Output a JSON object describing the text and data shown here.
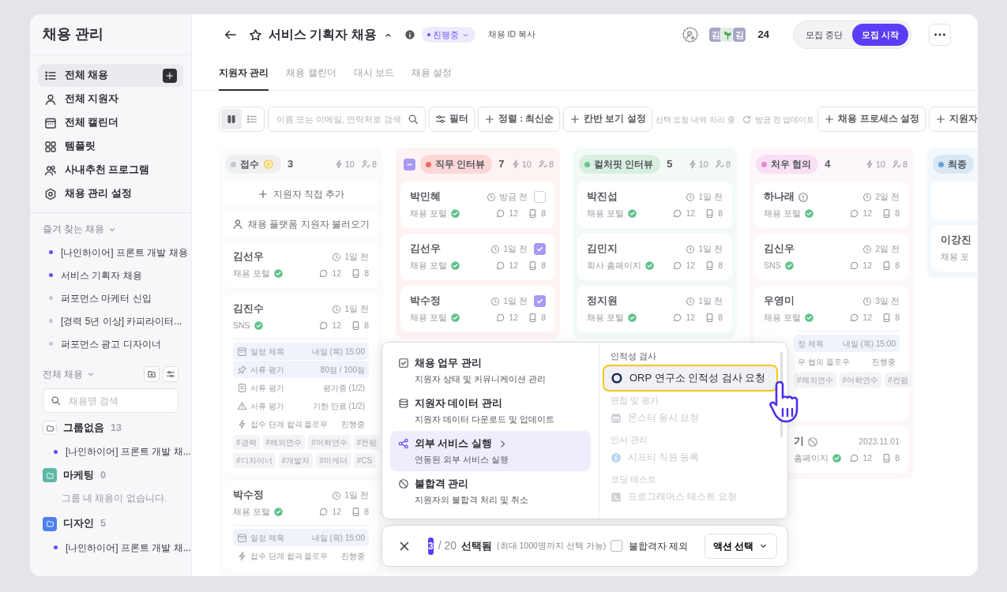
{
  "sidebar": {
    "title": "채용 관리",
    "nav": [
      {
        "kind": "list",
        "label": "전체 채용",
        "selected": true,
        "add_button": true
      },
      {
        "kind": "user",
        "label": "전체 지원자",
        "selected": false,
        "add_button": false
      },
      {
        "kind": "calendar",
        "label": "전체 캘린더",
        "selected": false,
        "add_button": false
      },
      {
        "kind": "grid",
        "label": "템플릿",
        "selected": false,
        "add_button": false
      },
      {
        "kind": "users",
        "label": "사내추천 프로그램",
        "selected": false,
        "add_button": false
      },
      {
        "kind": "hexagon",
        "label": "채용 관리 설정",
        "selected": false,
        "add_button": false
      }
    ],
    "favorites": {
      "title": "즐겨 찾는 채용",
      "items": [
        {
          "label": "[나인하이어] 프론트 개발 채용",
          "color": "#6b4cf6"
        },
        {
          "label": "서비스 기획자 채용",
          "color": "#6b4cf6"
        },
        {
          "label": "퍼포먼스 마케터 신입",
          "color": "#c3c6d0"
        },
        {
          "label": "[경력 5년 이상] 카피라이터...",
          "color": "#c3c6d0"
        },
        {
          "label": "퍼포먼스 광고 디자이너",
          "color": "#c3c6d0"
        }
      ]
    },
    "all_jobs": {
      "title": "전체 채용",
      "search_placeholder": "채용명 검색",
      "groups": [
        {
          "name": "그룹없음",
          "count": "13",
          "color": "#ffffff",
          "items": [
            {
              "label": "[나인하이어] 프론트 개발 채...",
              "color": "#6b4cf6"
            }
          ]
        },
        {
          "name": "마케팅",
          "count": "0",
          "color": "#5cb8a5",
          "empty_text": "그룹 내 채용이 없습니다."
        },
        {
          "name": "디자인",
          "count": "5",
          "color": "#4f7ff0",
          "items": [
            {
              "label": "[나인하이어] 프론트 개발 채...",
              "color": "#6b4cf6"
            }
          ]
        }
      ]
    }
  },
  "header": {
    "title": "서비스 기획자 채용",
    "status": "진행중",
    "copy_link": "채용 ID 복사",
    "avatars": [
      {
        "kind": "initial",
        "text": "김",
        "color": "#a5a6c4"
      },
      {
        "kind": "sprout",
        "color": "#dfeee0"
      },
      {
        "kind": "initial",
        "text": "김",
        "color": "#a5a6c4"
      }
    ],
    "member_count": "24",
    "recruit_toggle": [
      {
        "label": "모집 중단",
        "selected": false
      },
      {
        "label": "모집 시작",
        "selected": true
      }
    ]
  },
  "tabs": [
    {
      "label": "지원자 관리",
      "selected": true
    },
    {
      "label": "채용 캘린더",
      "selected": false
    },
    {
      "label": "대시 보드",
      "selected": false
    },
    {
      "label": "채용 설정",
      "selected": false
    }
  ],
  "toolbar": {
    "views": [
      {
        "kind": "kanban",
        "selected": true
      },
      {
        "kind": "list",
        "selected": false
      }
    ],
    "search_placeholder": "이름 또는 이메일, 연락처로 검색",
    "buttons": [
      {
        "kind": "sliders",
        "label": "필터"
      },
      {
        "kind": "plus",
        "label": "정렬 : 최신순"
      },
      {
        "kind": "plus",
        "label": "칸반 보기 설정"
      }
    ],
    "processing_text": "선택 요청 내역 처리 중",
    "updated_text": "방금 전 업데이트",
    "right_buttons": [
      {
        "kind": "plus",
        "label": "채용 프로세스 설정"
      },
      {
        "kind": "plus",
        "label": "지원자"
      }
    ]
  },
  "columns": [
    {
      "title": "접수",
      "color": "#c3c6d0",
      "indicator": true,
      "count": "3",
      "stats": [
        "10",
        "8"
      ],
      "actions": [
        {
          "kind": "add",
          "label": "지원자 직접 추가"
        },
        {
          "kind": "import",
          "label": "채용 플랫폼 지원자 불러오기"
        }
      ],
      "cards": [
        {
          "name": "김선우",
          "time": "1일 전",
          "source": "채용 포털",
          "verified": true,
          "comments": "12",
          "docs": "8"
        },
        {
          "name": "김진수",
          "time": "1일 전",
          "source": "SNS",
          "verified": true,
          "comments": "12",
          "docs": "8",
          "details": [
            {
              "kind": "calendar",
              "label": "일정 제목",
              "value": "내일 (목) 15:00",
              "highlight": true
            },
            {
              "kind": "pin",
              "label": "서류 평가",
              "value": "80점 / 100점",
              "highlight": true
            },
            {
              "kind": "note",
              "label": "서류 평가",
              "value": "평가중 (1/2)",
              "highlight": false
            },
            {
              "kind": "warning",
              "label": "서류 평가",
              "value": "기한 만료 (1/2)",
              "highlight": false
            },
            {
              "kind": "flow",
              "label": "접수 단계 합격 플로우",
              "value": "진행중",
              "highlight": false
            }
          ],
          "tags": [
            "#경력",
            "#해외연수",
            "#어학연수",
            "#컨펌",
            "#디자이너",
            "#개발자",
            "#마케터",
            "#CS"
          ]
        },
        {
          "name": "박수정",
          "time": "1일 전",
          "source": "채용 포털",
          "verified": true,
          "comments": "12",
          "docs": "8",
          "details": [
            {
              "kind": "calendar",
              "label": "일정 제목",
              "value": "내일 (목) 15:00",
              "highlight": true
            },
            {
              "kind": "flow",
              "label": "접수 단계 합격 플로우",
              "value": "진행중",
              "highlight": false
            }
          ]
        }
      ]
    },
    {
      "title": "직무 인터뷰",
      "color": "#f06a6a",
      "indicator": false,
      "partially_selected": true,
      "count": "7",
      "stats": [
        "10",
        "8"
      ],
      "cards": [
        {
          "name": "박민혜",
          "time": "방금 전",
          "source": "채용 포털",
          "verified": true,
          "comments": "12",
          "docs": "8",
          "checked": false
        },
        {
          "name": "김선우",
          "time": "1일 전",
          "source": "채용 포털",
          "verified": true,
          "comments": "12",
          "docs": "8",
          "checked": true
        },
        {
          "name": "박수정",
          "time": "1일 전",
          "source": "채용 포털",
          "verified": true,
          "comments": "12",
          "docs": "8",
          "checked": true
        }
      ]
    },
    {
      "title": "컬처핏 인터뷰",
      "color": "#6cc48a",
      "indicator": false,
      "count": "5",
      "stats": [
        "10",
        "8"
      ],
      "cards": [
        {
          "name": "박진섭",
          "time": "1일 전",
          "source": "채용 포털",
          "verified": true,
          "comments": "12",
          "docs": "8"
        },
        {
          "name": "김민지",
          "time": "1일 전",
          "source": "회사 홈페이지",
          "verified": true,
          "comments": "12",
          "docs": "8"
        },
        {
          "name": "정지원",
          "time": "1일 전",
          "source": "채용 포털",
          "verified": true,
          "comments": "12",
          "docs": "8"
        }
      ]
    },
    {
      "title": "처우 협의",
      "color": "#e58ad0",
      "indicator": false,
      "count": "4",
      "stats": [
        "10",
        "8"
      ],
      "cards": [
        {
          "name": "하나래",
          "info": true,
          "time": "2일 전",
          "source": "채용 포털",
          "verified": true,
          "comments": "12",
          "docs": "8"
        },
        {
          "name": "김신우",
          "time": "2일 전",
          "source": "SNS",
          "verified": true,
          "comments": "12",
          "docs": "8"
        },
        {
          "name": "우영미",
          "time": "3일 전",
          "source": "채용 포털",
          "verified": true,
          "comments": "12",
          "docs": "8",
          "details_covered": true,
          "details": [
            {
              "label": "정 제목",
              "value": "내일 (목) 15:00",
              "highlight": true
            },
            {
              "label": "우 협의 플로우",
              "value": "진행중",
              "highlight": false
            }
          ],
          "tags": [
            "#해외연수",
            "#어학연수",
            "#컨펌"
          ]
        },
        {
          "name": "기",
          "rejected": true,
          "time": "2023.11.01",
          "clock": false,
          "source": "홈페이지",
          "verified": true,
          "comments": "12",
          "docs": "8",
          "covered": true
        }
      ]
    },
    {
      "title": "최종",
      "color": "#6aa5d8",
      "indicator": false,
      "actions": [
        {
          "kind": "blank"
        }
      ],
      "cards": [
        {
          "name": "이강진",
          "source": "채용 포"
        }
      ]
    }
  ],
  "action_menu": {
    "categories": [
      {
        "kind": "checklist",
        "title": "채용 업무 관리",
        "description": "지원자 상태 및 커뮤니케이션 관리",
        "selected": false,
        "submenu": false
      },
      {
        "kind": "database",
        "title": "지원자 데이터 관리",
        "description": "지원자 데이터 다운로드 및 업데이트",
        "selected": false,
        "submenu": false
      },
      {
        "kind": "share",
        "title": "외부 서비스 실행",
        "description": "연동된 외부 서비스 실행",
        "selected": true,
        "submenu": true
      },
      {
        "kind": "ban",
        "title": "불합격 관리",
        "description": "지원자의 불합격 처리 및 취소",
        "selected": false,
        "submenu": false
      }
    ],
    "services": [
      {
        "title": "인적성 검사",
        "disabled": false,
        "items": [
          {
            "kind": "ring",
            "label": "ORP 연구소 인적성 검사 요청",
            "selected": true
          }
        ]
      },
      {
        "title": "면접 및 평가",
        "disabled": true,
        "items": [
          {
            "kind": "monster",
            "label": "몬스터 응시 요청",
            "selected": false
          }
        ]
      },
      {
        "title": "인사 관리",
        "disabled": true,
        "items": [
          {
            "kind": "boltcircle",
            "label": "시프티 직원 등록",
            "selected": false
          }
        ]
      },
      {
        "title": "코딩 테스트",
        "disabled": true,
        "items": [
          {
            "kind": "prog",
            "label": "프로그래머스 테스트 요청",
            "selected": false
          }
        ]
      }
    ]
  },
  "selection_bar": {
    "selected_count": "3",
    "total": "/ 20",
    "label": "선택됨",
    "hint": "(최대 1000명까지 선택 가능)",
    "exclude_rejected": {
      "label": "불합격자 제외",
      "checked": false
    },
    "action_button": "액션 선택"
  }
}
